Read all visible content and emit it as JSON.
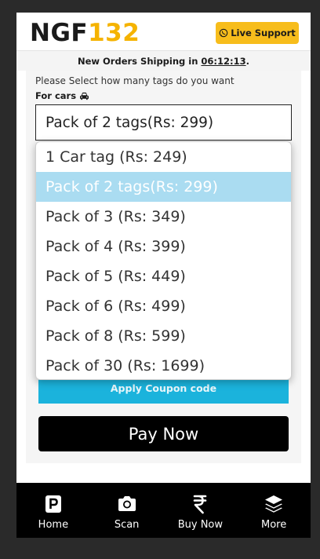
{
  "header": {
    "logo_part1": "NGF",
    "logo_part2": "132",
    "support_label": "Live Support",
    "support_icon": "whatsapp-icon"
  },
  "shipping": {
    "prefix": "New Orders Shipping in",
    "time": "06:12:13",
    "suffix": "."
  },
  "form": {
    "prompt": "Please Select how many tags do you want",
    "for_label": "For cars",
    "for_icon": "car-icon",
    "selected_value": "Pack of 2 tags(Rs: 299)",
    "options": [
      "1 Car tag (Rs: 249)",
      "Pack of 2 tags(Rs: 299)",
      "Pack of 3 (Rs: 349)",
      "Pack of 4 (Rs: 399)",
      "Pack of 5 (Rs: 449)",
      "Pack of 6 (Rs: 499)",
      "Pack of 8 (Rs: 599)",
      "Pack of 30 (Rs: 1699)"
    ],
    "selected_index": 1,
    "coupon_label": "Apply Coupon code",
    "pay_label": "Pay Now"
  },
  "nav": [
    {
      "label": "Home",
      "icon": "parking-icon"
    },
    {
      "label": "Scan",
      "icon": "camera-icon"
    },
    {
      "label": "Buy Now",
      "icon": "rupee-icon"
    },
    {
      "label": "More",
      "icon": "layers-icon"
    }
  ],
  "colors": {
    "accent_yellow": "#f7bd1c",
    "coupon_blue": "#1bb3dc",
    "selected_option": "#aadcf1"
  }
}
